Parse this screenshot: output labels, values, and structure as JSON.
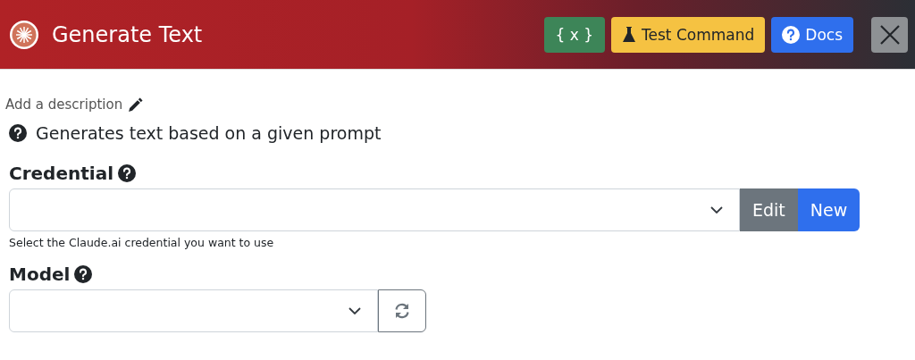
{
  "header": {
    "title": "Generate Text",
    "buttons": [
      {
        "kind": "variables",
        "label": "{ x }"
      },
      {
        "kind": "test",
        "label": "Test Command"
      },
      {
        "kind": "docs",
        "label": "Docs"
      },
      {
        "kind": "close"
      }
    ]
  },
  "description_link": "Add a description",
  "help_text": "Generates text based on a given prompt",
  "fields": [
    {
      "label": "Credential",
      "hint": "Select the Claude.ai credential you want to use",
      "actions": [
        {
          "kind": "edit",
          "label": "Edit"
        },
        {
          "kind": "new",
          "label": "New"
        }
      ]
    },
    {
      "label": "Model",
      "actions": [
        {
          "kind": "refresh"
        }
      ]
    }
  ]
}
